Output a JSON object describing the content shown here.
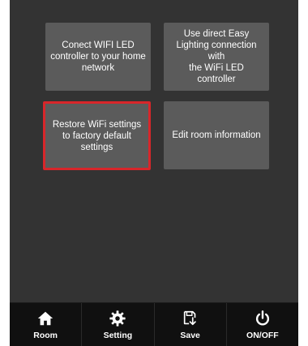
{
  "tiles": [
    {
      "label": "Conect WIFI LED\ncontroller to your home\nnetwork",
      "selected": false
    },
    {
      "label": "Use direct Easy\nLighting connection with\nthe WiFi LED controller",
      "selected": false
    },
    {
      "label": "Restore WiFi settings\nto factory default settings",
      "selected": true
    },
    {
      "label": "Edit room information",
      "selected": false
    }
  ],
  "selection_color": "#d8262a",
  "bottom_nav": {
    "room": {
      "label": "Room",
      "icon": "home-icon"
    },
    "setting": {
      "label": "Setting",
      "icon": "gear-icon"
    },
    "save": {
      "label": "Save",
      "icon": "save-icon"
    },
    "onoff": {
      "label": "ON/OFF",
      "icon": "power-icon"
    }
  }
}
